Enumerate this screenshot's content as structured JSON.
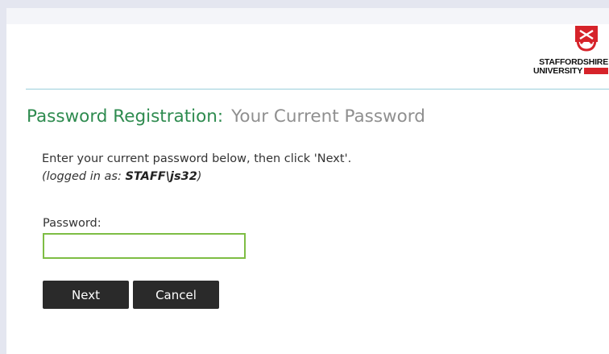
{
  "logo": {
    "line1": "STAFFORDSHIRE",
    "line2": "UNIVERSITY",
    "icon": "stafford-knot-icon",
    "brand_color": "#d6232a"
  },
  "page": {
    "title": "Password Registration:",
    "subtitle": "Your Current Password",
    "title_color": "#2e8b4f",
    "subtitle_color": "#8f8f8f"
  },
  "instruction": "Enter your current password below, then click 'Next'.",
  "login_info": {
    "prefix": "(logged in as: ",
    "user": "STAFF\\js32",
    "suffix": ")"
  },
  "password_field": {
    "label": "Password:",
    "value": "",
    "border_color": "#7ebd44"
  },
  "buttons": {
    "next": "Next",
    "cancel": "Cancel"
  }
}
